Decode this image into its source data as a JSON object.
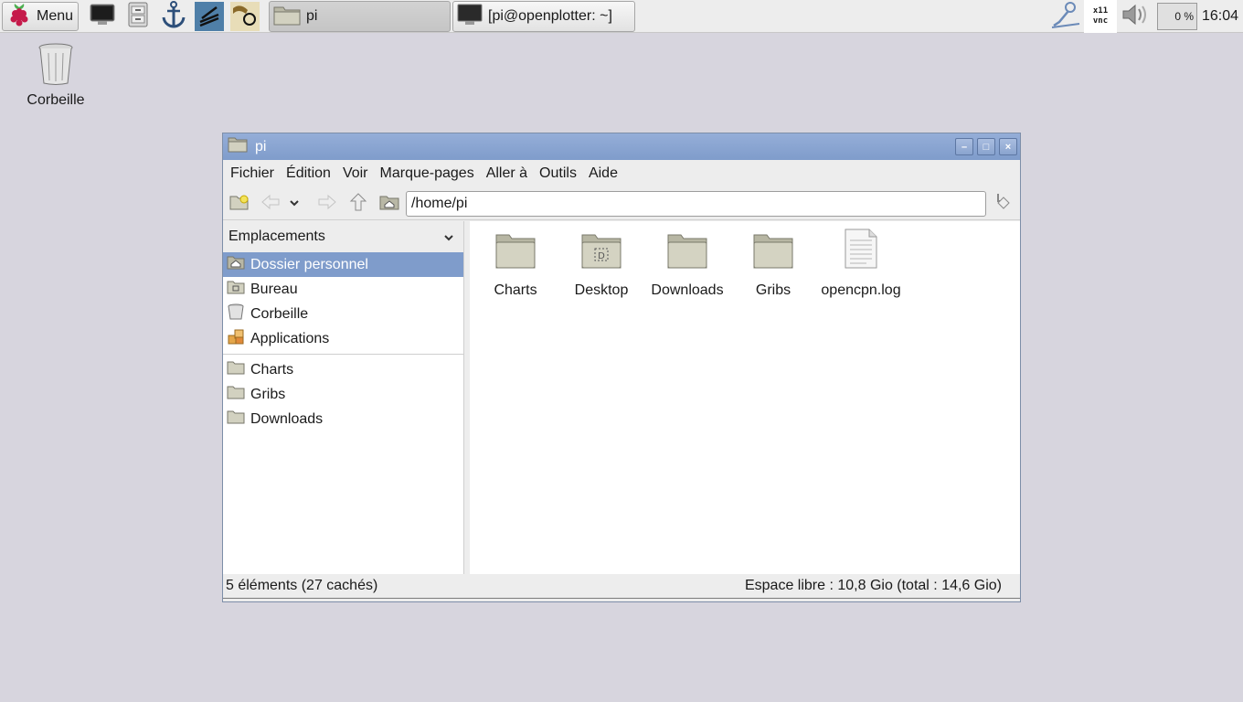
{
  "taskbar": {
    "menu_label": "Menu",
    "launchers": [
      "terminal-icon",
      "file-manager-icon",
      "anchor-icon",
      "chart-plotter-icon",
      "map-tool-icon"
    ],
    "tasks": [
      {
        "label": "pi",
        "icon": "folder-icon",
        "active": true
      },
      {
        "label": "[pi@openplotter: ~]",
        "icon": "terminal-icon",
        "active": false
      }
    ],
    "tray": {
      "vnc_line1": "x11",
      "vnc_line2": "vnc",
      "cpu_usage": "0 %",
      "clock": "16:04"
    }
  },
  "desktop": {
    "trash_label": "Corbeille"
  },
  "window": {
    "title": "pi",
    "controls": {
      "minimize": "–",
      "maximize": "□",
      "close": "×"
    },
    "menu": [
      "Fichier",
      "Édition",
      "Voir",
      "Marque-pages",
      "Aller à",
      "Outils",
      "Aide"
    ],
    "path": "/home/pi",
    "sidebar": {
      "header": "Emplacements",
      "places": [
        {
          "label": "Dossier personnel",
          "icon": "home-folder-icon",
          "selected": true
        },
        {
          "label": "Bureau",
          "icon": "desktop-folder-icon",
          "selected": false
        },
        {
          "label": "Corbeille",
          "icon": "trash-icon",
          "selected": false
        },
        {
          "label": "Applications",
          "icon": "applications-icon",
          "selected": false
        }
      ],
      "bookmarks": [
        {
          "label": "Charts",
          "icon": "folder-icon"
        },
        {
          "label": "Gribs",
          "icon": "folder-icon"
        },
        {
          "label": "Downloads",
          "icon": "folder-icon"
        }
      ]
    },
    "files": [
      {
        "name": "Charts",
        "type": "folder"
      },
      {
        "name": "Desktop",
        "type": "desktop-folder"
      },
      {
        "name": "Downloads",
        "type": "folder"
      },
      {
        "name": "Gribs",
        "type": "folder"
      },
      {
        "name": "opencpn.log",
        "type": "text-file"
      }
    ],
    "status_left": "5 éléments (27 cachés)",
    "status_right": "Espace libre : 10,8 Gio (total : 14,6 Gio)"
  },
  "colors": {
    "desktop_bg": "#d7d5de",
    "title_bar": "#8aa5d1",
    "selection": "#7f9ccb"
  }
}
